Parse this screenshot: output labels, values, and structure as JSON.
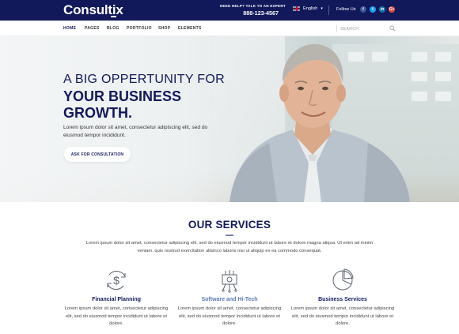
{
  "brand": {
    "logo": "Consultix",
    "color_primary": "#12195b"
  },
  "topbar": {
    "help_label": "NEED HELP? TALK TO AN EXPERT",
    "phone": "888-123-4567",
    "language": "English",
    "follow_label": "Follow Us",
    "social": [
      {
        "icon": "facebook-icon",
        "glyph": "f"
      },
      {
        "icon": "twitter-icon",
        "glyph": "t"
      },
      {
        "icon": "linkedin-icon",
        "glyph": "in"
      },
      {
        "icon": "google-plus-icon",
        "glyph": "G+"
      }
    ]
  },
  "nav": {
    "items": [
      "HOME",
      "PAGES",
      "BLOG",
      "PORTFOLIO",
      "SHOP",
      "ELEMENTS"
    ],
    "active": "HOME",
    "search_placeholder": "SEARCH"
  },
  "hero": {
    "line1": "A BIG OPPERTUNITY FOR",
    "line2": "YOUR BUSINESS",
    "line3": "GROWTH.",
    "description": "Lorem ipsum dolor sit amet, consectetur adipiscing elit, sed do eiusmod tempor incididunt.",
    "cta": "ASK FOR CONSULTATION"
  },
  "services": {
    "title": "OUR SERVICES",
    "intro": "Lorem ipsum dolor sit amet, consectetur adipiscing elit, sed do eiusmod tempor incididunt ut labore et dolore magna aliqua. Ut enim ad minim veniam, quis nostrud exercitation ullamco laboris nisi ut aliquip ex ea commodo consequat.",
    "items": [
      {
        "icon": "dollar-cycle-icon",
        "name": "Financial Planning",
        "text": "Lorem ipsum dolor sit amet, consectetur adipiscing elit, sed do eiusmod tempor incididunt ut labore et dolore."
      },
      {
        "icon": "circuit-chip-icon",
        "name": "Software and Hi-Tech",
        "text": "Lorem ipsum dolor sit amet, consectetur adipiscing elit, sed do eiusmod tempor incididunt ut labore et dolore."
      },
      {
        "icon": "pie-chart-icon",
        "name": "Business Services",
        "text": "Lorem ipsum dolor sit amet, consectetur adipiscing elit, sed do eiusmod tempor incididunt ut labore et dolore."
      }
    ]
  }
}
